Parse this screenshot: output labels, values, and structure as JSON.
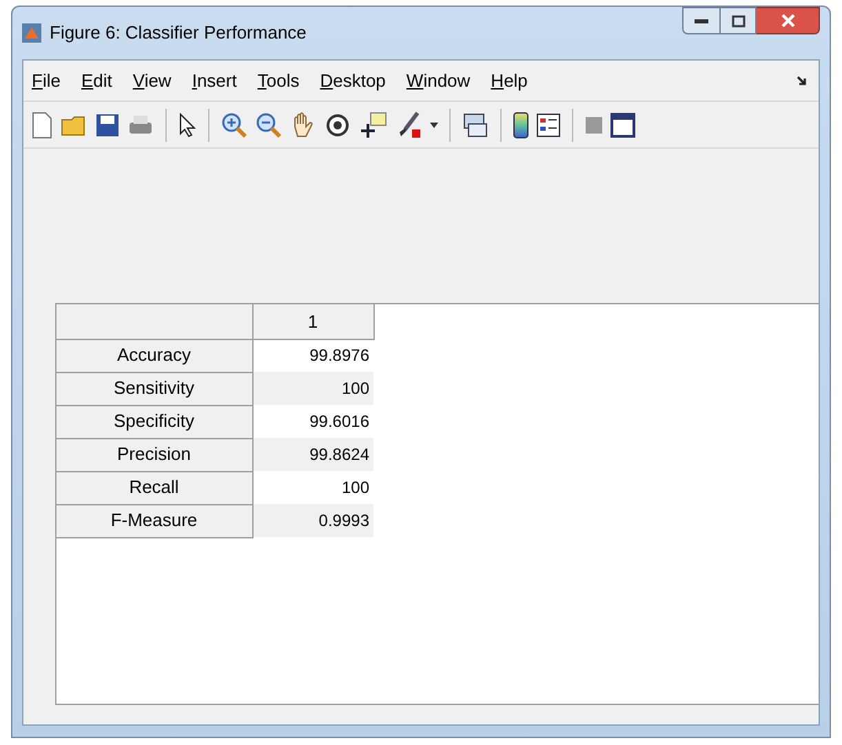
{
  "window": {
    "title": "Figure 6: Classifier Performance"
  },
  "menu": [
    "File",
    "Edit",
    "View",
    "Insert",
    "Tools",
    "Desktop",
    "Window",
    "Help"
  ],
  "table": {
    "columns": [
      "1"
    ],
    "rows": [
      {
        "label": "Accuracy",
        "value": "99.8976"
      },
      {
        "label": "Sensitivity",
        "value": "100"
      },
      {
        "label": "Specificity",
        "value": "99.6016"
      },
      {
        "label": "Precision",
        "value": "99.8624"
      },
      {
        "label": "Recall",
        "value": "100"
      },
      {
        "label": "F-Measure",
        "value": "0.9993"
      }
    ]
  }
}
